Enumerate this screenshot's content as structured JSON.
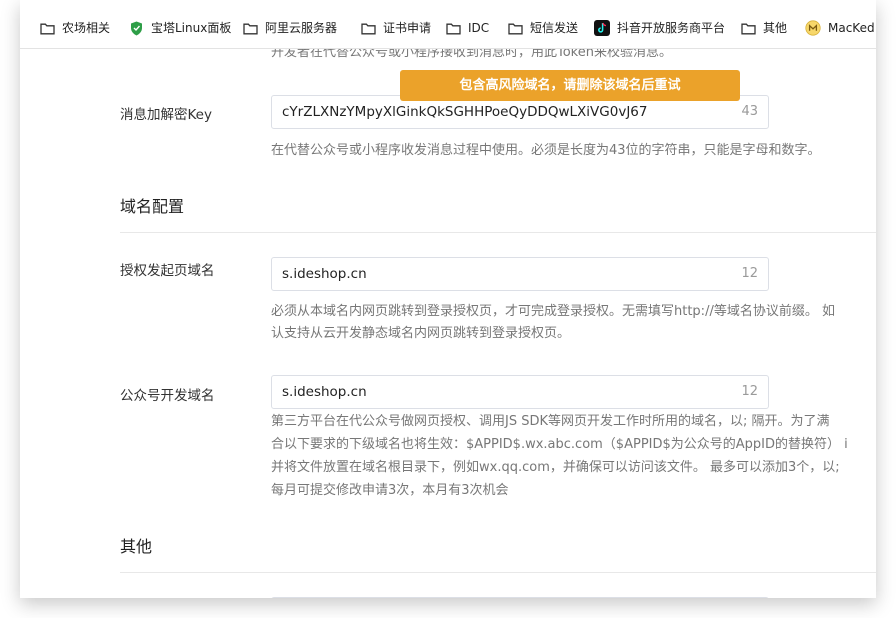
{
  "bookmarks": [
    {
      "label": "农场相关",
      "icon": "folder-icon"
    },
    {
      "label": "宝塔Linux面板",
      "icon": "shield-icon"
    },
    {
      "label": "阿里云服务器",
      "icon": "folder-icon"
    },
    {
      "label": "证书申请",
      "icon": "folder-icon"
    },
    {
      "label": "IDC",
      "icon": "folder-icon"
    },
    {
      "label": "短信发送",
      "icon": "folder-icon"
    },
    {
      "label": "抖音开放服务商平台",
      "icon": "tiktok-icon"
    },
    {
      "label": "其他",
      "icon": "folder-icon"
    },
    {
      "label": "MacKed",
      "icon": "macked-icon"
    }
  ],
  "toast": "包含高风险域名，请删除该域名后重试",
  "top_desc": "开发者在代替公众号或小程序接收到消息时，用此Token来校验消息。",
  "aes_key": {
    "label": "消息加解密Key",
    "value": "cYrZLXNzYMpyXlGinkQkSGHHPoeQyDDQwLXiVG0vJ67",
    "count": "43",
    "desc": "在代替公众号或小程序收发消息过程中使用。必须是长度为43位的字符串，只能是字母和数字。"
  },
  "domain_section": "域名配置",
  "auth_domain": {
    "label": "授权发起页域名",
    "value": "s.ideshop.cn",
    "count": "12",
    "desc_line1": "必须从本域名内网页跳转到登录授权页，才可完成登录授权。无需填写http://等域名协议前缀。 如",
    "desc_line2": "认支持从云开发静态域名内网页跳转到登录授权页。"
  },
  "mp_domain": {
    "label": "公众号开发域名",
    "value": "s.ideshop.cn",
    "count": "12",
    "desc_line1": "第三方平台在代公众号做网页授权、调用JS SDK等网页开发工作时所用的域名，以; 隔开。为了满",
    "desc_line2": "合以下要求的下级域名也将生效：$APPID$.wx.abc.com（$APPID$为公众号的AppID的替换符） i",
    "desc_line3": "并将文件放置在域名根目录下，例如wx.qq.com，并确保可以访问该文件。 最多可以添加3个，以;",
    "desc_line4": "每月可提交修改申请3次，本月有3次机会"
  },
  "other_section": "其他",
  "colors": {
    "toast_bg": "#eba22a",
    "shield_green": "#2e9e47"
  }
}
